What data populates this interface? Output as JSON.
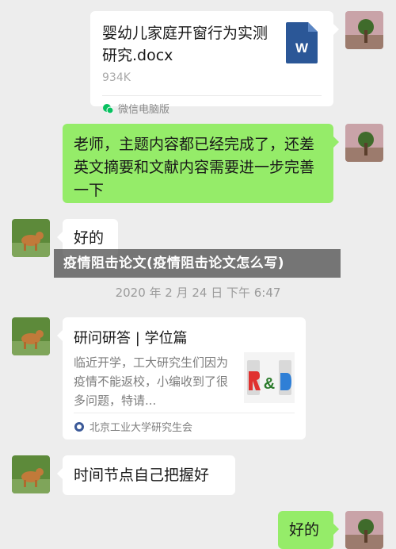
{
  "messages": {
    "file": {
      "name": "婴幼儿家庭开窗行为实测研究.docx",
      "size": "934K",
      "source": "微信电脑版",
      "icon": "word-doc-icon",
      "icon_letter": "W"
    },
    "teacher_msg": "老师，主题内容都已经完成了，还差英文摘要和文献内容需要进一步完善一下",
    "reply_ok": "好的",
    "timestamp": "2020 年 2 月 24 日 下午 6:47",
    "card": {
      "title": "研问研答 | 学位篇",
      "desc": "临近开学，工大研究生们因为疫情不能返校，小编收到了很多问题，特请...",
      "source": "北京工业大学研究生会",
      "thumb_icon": "r-and-d-icon"
    },
    "time_node_msg": "时间节点自己把握好",
    "bottom_reply": "好的"
  },
  "overlay_title": "疫情阻击论文(疫情阻击论文怎么写)",
  "colors": {
    "background": "#ededed",
    "self_bubble": "#95ec69",
    "other_bubble": "#ffffff",
    "word_blue": "#2b5797"
  }
}
